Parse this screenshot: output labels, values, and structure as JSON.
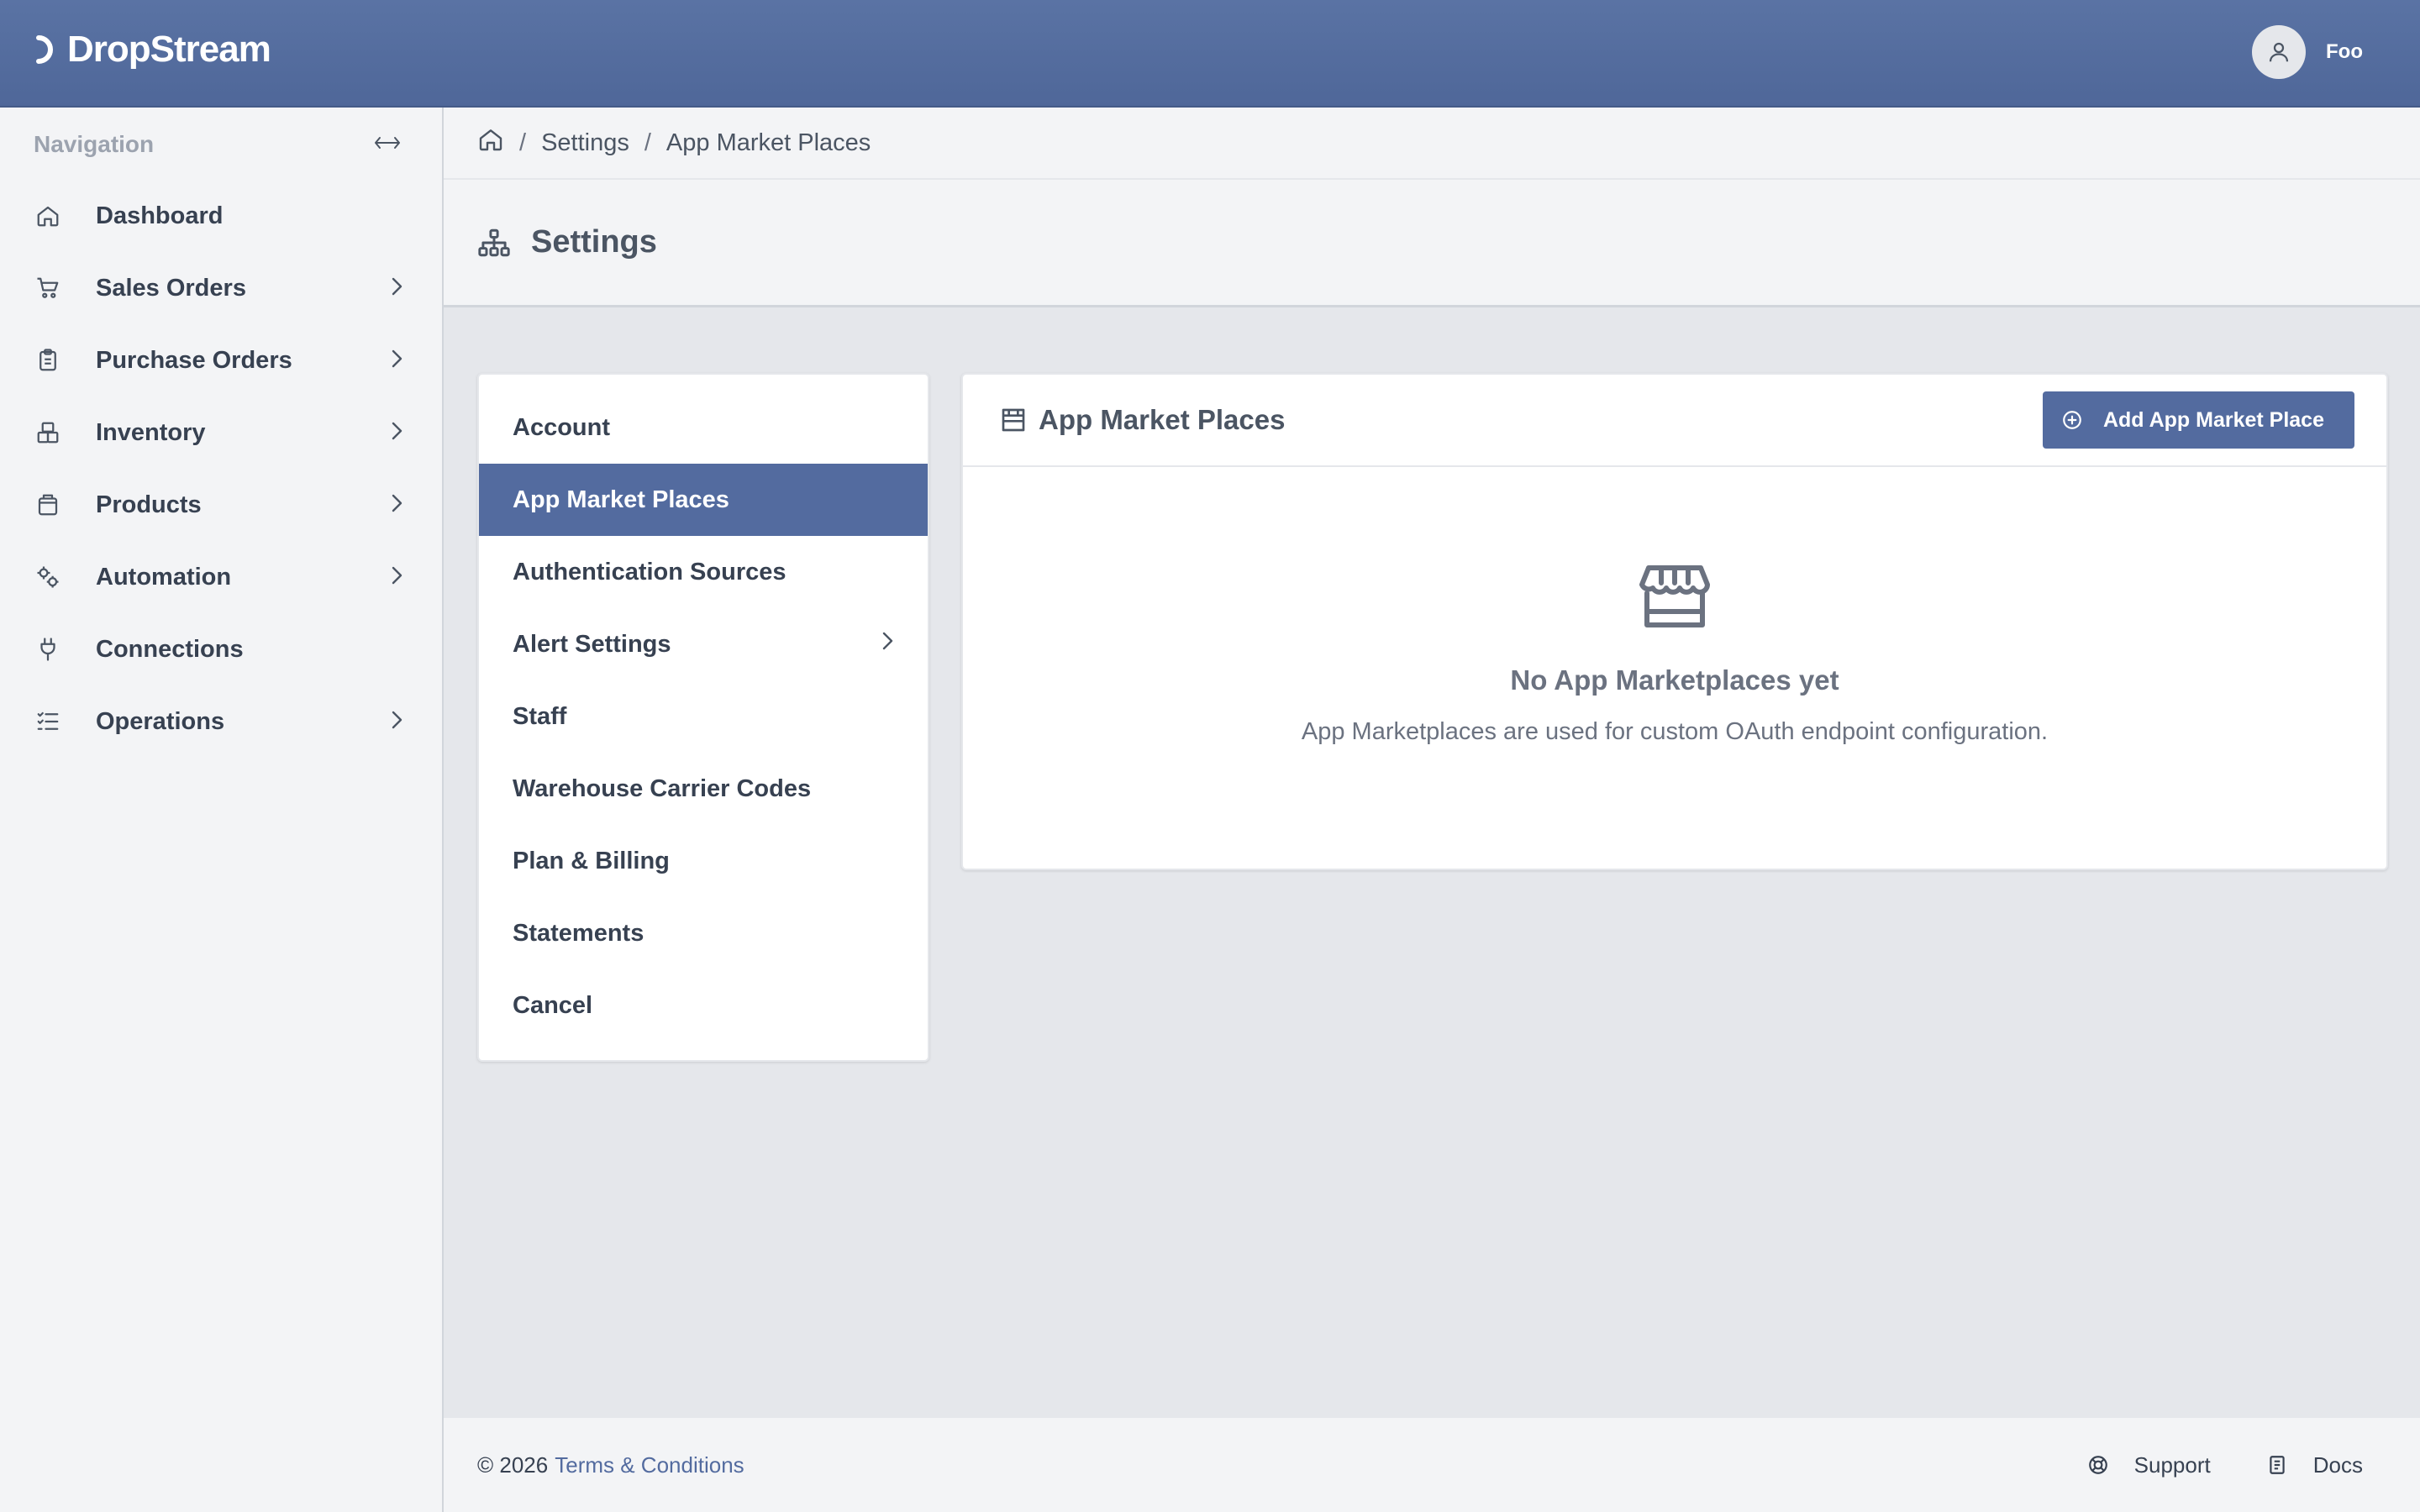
{
  "app": {
    "brand": "DropStream"
  },
  "user": {
    "name": "Foo"
  },
  "sidebar": {
    "title": "Navigation",
    "items": [
      {
        "label": "Dashboard",
        "icon": "home-icon",
        "has_children": false
      },
      {
        "label": "Sales Orders",
        "icon": "cart-icon",
        "has_children": true
      },
      {
        "label": "Purchase Orders",
        "icon": "clipboard-icon",
        "has_children": true
      },
      {
        "label": "Inventory",
        "icon": "boxes-icon",
        "has_children": true
      },
      {
        "label": "Products",
        "icon": "package-icon",
        "has_children": true
      },
      {
        "label": "Automation",
        "icon": "gears-icon",
        "has_children": true
      },
      {
        "label": "Connections",
        "icon": "plug-icon",
        "has_children": false
      },
      {
        "label": "Operations",
        "icon": "list-check-icon",
        "has_children": true
      }
    ]
  },
  "breadcrumb": {
    "items": [
      "Settings",
      "App Market Places"
    ],
    "separator": "/"
  },
  "page": {
    "title": "Settings"
  },
  "settings_menu": {
    "items": [
      {
        "label": "Account",
        "active": false,
        "has_children": false
      },
      {
        "label": "App Market Places",
        "active": true,
        "has_children": false
      },
      {
        "label": "Authentication Sources",
        "active": false,
        "has_children": false
      },
      {
        "label": "Alert Settings",
        "active": false,
        "has_children": true
      },
      {
        "label": "Staff",
        "active": false,
        "has_children": false
      },
      {
        "label": "Warehouse Carrier Codes",
        "active": false,
        "has_children": false
      },
      {
        "label": "Plan & Billing",
        "active": false,
        "has_children": false
      },
      {
        "label": "Statements",
        "active": false,
        "has_children": false
      },
      {
        "label": "Cancel",
        "active": false,
        "has_children": false
      }
    ]
  },
  "panel": {
    "title": "App Market Places",
    "add_button": "Add App Market Place",
    "empty_title": "No App Marketplaces yet",
    "empty_desc": "App Marketplaces are used for custom OAuth endpoint configuration."
  },
  "footer": {
    "copyright": "© 2026",
    "terms": "Terms & Conditions",
    "support": "Support",
    "docs": "Docs"
  },
  "colors": {
    "header": "#536b9f",
    "accent": "#536b9f",
    "sidebar_bg": "#f3f4f6",
    "content_bg": "#e5e7eb"
  }
}
